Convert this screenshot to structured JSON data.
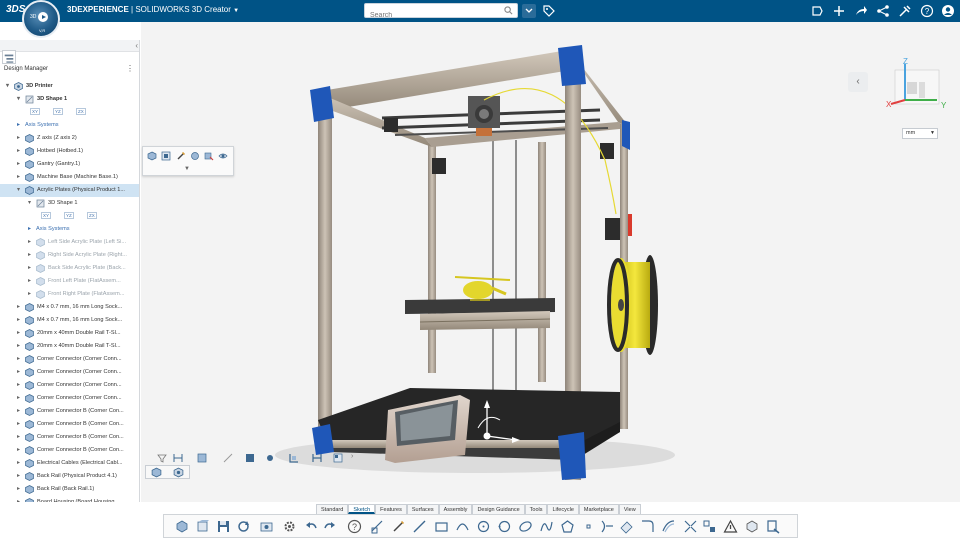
{
  "app": {
    "logo": "3DS",
    "brand_name": "3DEXPERIENCE",
    "separator": " | ",
    "product": "SOLIDWORKS",
    "role": "3D Creator",
    "compass_label": "3D",
    "compass_vr": "V,R"
  },
  "search": {
    "placeholder": "Search"
  },
  "top_icons": [
    "tag-icon",
    "share-icon",
    "add-icon",
    "forward-icon",
    "network-icon",
    "tools-icon",
    "help-icon",
    "user-icon"
  ],
  "design_manager": {
    "title": "Design Manager",
    "tree": [
      {
        "label": "3D Printer",
        "level": 0,
        "expand": "open",
        "icon": "assembly-icon",
        "bold": true
      },
      {
        "label": "3D Shape 1",
        "level": 1,
        "expand": "open",
        "icon": "shape-icon",
        "bold": true
      },
      {
        "label": "",
        "level": 2,
        "type": "axes",
        "axes": [
          "XY",
          "YZ",
          "ZX"
        ]
      },
      {
        "label": "Axis Systems",
        "level": 1,
        "expand": "closed",
        "type": "link"
      },
      {
        "label": "Z axis (Z axis 2)",
        "level": 1,
        "expand": "closed",
        "icon": "part-icon"
      },
      {
        "label": "Hotbed (Hotbed.1)",
        "level": 1,
        "expand": "closed",
        "icon": "part-icon"
      },
      {
        "label": "Gantry (Gantry.1)",
        "level": 1,
        "expand": "closed",
        "icon": "part-icon"
      },
      {
        "label": "Machine Base (Machine Base.1)",
        "level": 1,
        "expand": "closed",
        "icon": "part-icon"
      },
      {
        "label": "Acrylic Plates (Physical Product 1...",
        "level": 1,
        "expand": "open",
        "icon": "part-icon",
        "selected": true
      },
      {
        "label": "3D Shape 1",
        "level": 2,
        "expand": "open",
        "icon": "shape-icon"
      },
      {
        "label": "",
        "level": 3,
        "type": "axes",
        "axes": [
          "XY",
          "YZ",
          "ZX"
        ]
      },
      {
        "label": "Axis Systems",
        "level": 2,
        "expand": "closed",
        "type": "link"
      },
      {
        "label": "Left Side Acrylic Plate (Left Si...",
        "level": 2,
        "expand": "closed",
        "icon": "part-icon",
        "dim": true
      },
      {
        "label": "Right Side Acrylic Plate (Right...",
        "level": 2,
        "expand": "closed",
        "icon": "part-icon",
        "dim": true
      },
      {
        "label": "Back Side Acrylic Plate (Back...",
        "level": 2,
        "expand": "closed",
        "icon": "part-icon",
        "dim": true
      },
      {
        "label": "Front Left Plate (FlatAssem...",
        "level": 2,
        "expand": "closed",
        "icon": "part-icon",
        "dim": true
      },
      {
        "label": "Front Right Plate (FlatAssem...",
        "level": 2,
        "expand": "closed",
        "icon": "part-icon",
        "dim": true
      },
      {
        "label": "M4 x 0.7 mm, 16 mm Long Sock...",
        "level": 1,
        "expand": "closed",
        "icon": "part-icon"
      },
      {
        "label": "M4 x 0.7 mm, 16 mm Long Sock...",
        "level": 1,
        "expand": "closed",
        "icon": "part-icon"
      },
      {
        "label": "20mm x 40mm Double Rail T-Sl...",
        "level": 1,
        "expand": "closed",
        "icon": "part-icon"
      },
      {
        "label": "20mm x 40mm Double Rail T-Sl...",
        "level": 1,
        "expand": "closed",
        "icon": "part-icon"
      },
      {
        "label": "Corner Connector (Corner Conn...",
        "level": 1,
        "expand": "closed",
        "icon": "part-icon"
      },
      {
        "label": "Corner Connector (Corner Conn...",
        "level": 1,
        "expand": "closed",
        "icon": "part-icon"
      },
      {
        "label": "Corner Connector (Corner Conn...",
        "level": 1,
        "expand": "closed",
        "icon": "part-icon"
      },
      {
        "label": "Corner Connector (Corner Conn...",
        "level": 1,
        "expand": "closed",
        "icon": "part-icon"
      },
      {
        "label": "Corner Connector B (Corner Con...",
        "level": 1,
        "expand": "closed",
        "icon": "part-icon"
      },
      {
        "label": "Corner Connector B (Corner Con...",
        "level": 1,
        "expand": "closed",
        "icon": "part-icon"
      },
      {
        "label": "Corner Connector B (Corner Con...",
        "level": 1,
        "expand": "closed",
        "icon": "part-icon"
      },
      {
        "label": "Corner Connector B (Corner Con...",
        "level": 1,
        "expand": "closed",
        "icon": "part-icon"
      },
      {
        "label": "Electrical Cables (Electrical Cabl...",
        "level": 1,
        "expand": "closed",
        "icon": "part-icon"
      },
      {
        "label": "Back Rail (Physical Product 4.1)",
        "level": 1,
        "expand": "closed",
        "icon": "part-icon"
      },
      {
        "label": "Back Rail (Back Rail.1)",
        "level": 1,
        "expand": "closed",
        "icon": "part-icon"
      },
      {
        "label": "Board Housing (Board Housing...",
        "level": 1,
        "expand": "closed",
        "icon": "part-icon"
      }
    ]
  },
  "viewcube": {
    "z_label": "Z",
    "x_label": "X",
    "y_label": "Y"
  },
  "unit": {
    "selected": "mm"
  },
  "action_tabs": [
    "Standard",
    "Sketch",
    "Features",
    "Surfaces",
    "Assembly",
    "Design Guidance",
    "Tools",
    "Lifecycle",
    "Marketplace",
    "View"
  ],
  "active_tab": "Sketch",
  "colors": {
    "topbar": "#005386",
    "frame_blue": "#1f57b8",
    "aluminum": "#b9aea0",
    "filament_yellow": "#f1e234",
    "bed_dark": "#2b2b2b"
  }
}
